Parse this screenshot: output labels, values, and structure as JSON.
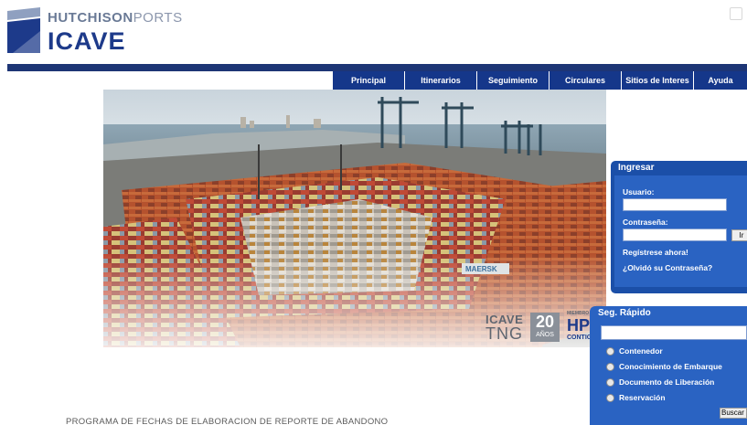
{
  "header": {
    "brand_primary": "HUTCHISON",
    "brand_secondary": "PORTS",
    "brand_name": "ICAVE"
  },
  "nav": {
    "items": [
      "Principal",
      "Itinerarios",
      "Seguimiento",
      "Circulares",
      "Sitios de Interes",
      "Ayuda"
    ]
  },
  "hero": {
    "logo_icave": "ICAVE",
    "logo_tng": "TNG",
    "logo_years": "20",
    "logo_years_label": "AÑOS",
    "logo_member": "MIEMBRO",
    "logo_hph": "HPH",
    "logo_contigo": "CONTIGO",
    "container_brand": "MAERSK"
  },
  "login": {
    "title": "Ingresar",
    "user_label": "Usuario:",
    "password_label": "Contraseña:",
    "user_value": "",
    "password_value": "",
    "submit_label": "Ir",
    "register_link": "Regístrese ahora!",
    "forgot_link": "¿Olvidó su Contraseña?"
  },
  "quick_search": {
    "title": "Seg. Rápido",
    "input_value": "",
    "options": [
      "Contenedor",
      "Conocimiento de Embarque",
      "Documento de Liberación",
      "Reservación"
    ],
    "search_label": "Buscar"
  },
  "footer": {
    "program_link": "PROGRAMA DE FECHAS DE ELABORACION DE REPORTE DE ABANDONO"
  },
  "colors": {
    "brand_navy": "#1d3575",
    "nav_blue": "#15378a",
    "panel_blue": "#2a63c2"
  }
}
